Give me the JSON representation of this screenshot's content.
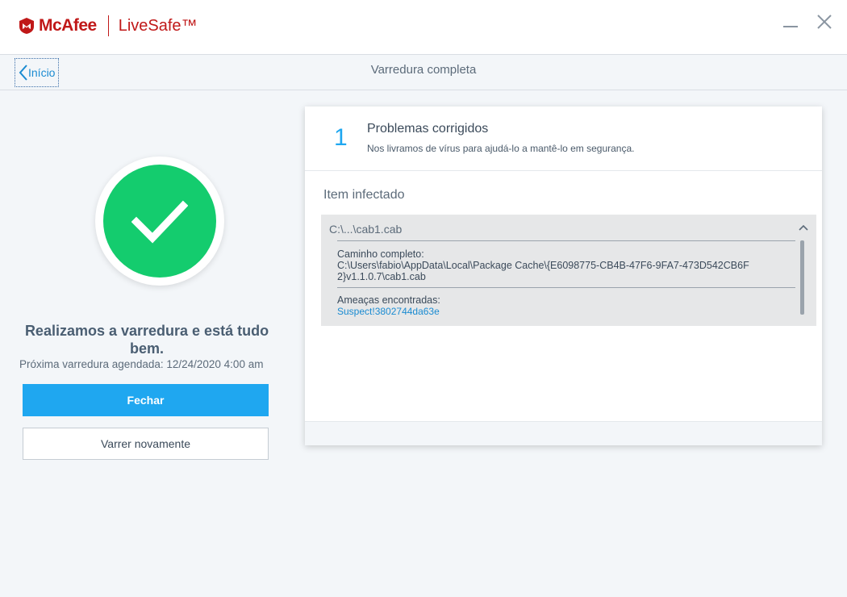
{
  "app": {
    "brand": "McAfee",
    "product": "LiveSafe™",
    "brand_color": "#c01818",
    "icons": {
      "logo": "mcafee-shield-icon",
      "minimize": "minimize-icon",
      "close": "close-icon"
    }
  },
  "nav": {
    "back_label": "Início",
    "title": "Varredura completa",
    "back_icon": "chevron-left-icon"
  },
  "result": {
    "icon": "checkmark-icon",
    "message": "Realizamos a varredura e está tudo bem.",
    "next_scan": "Próxima varredura agendada: 12/24/2020 4:00 am",
    "primary_button": "Fechar",
    "secondary_button": "Varrer novamente",
    "success_color": "#14cc6e",
    "accent_color": "#1fa7f0"
  },
  "summary": {
    "count": "1",
    "title": "Problemas corrigidos",
    "description": "Nos livramos de vírus para ajudá-lo a mantê-lo em segurança."
  },
  "infected": {
    "section_label": "Item infectado",
    "item": {
      "short_name": "C:\\...\\cab1.cab",
      "expand_icon": "chevron-up-icon",
      "path_label": "Caminho completo:",
      "path_value": "C:\\Users\\fabio\\AppData\\Local\\Package Cache\\{E6098775-CB4B-47F6-9FA7-473D542CB6F2}v1.1.0.7\\cab1.cab",
      "threats_label": "Ameaças encontradas:",
      "threats_value": "Suspect!3802744da63e"
    }
  }
}
